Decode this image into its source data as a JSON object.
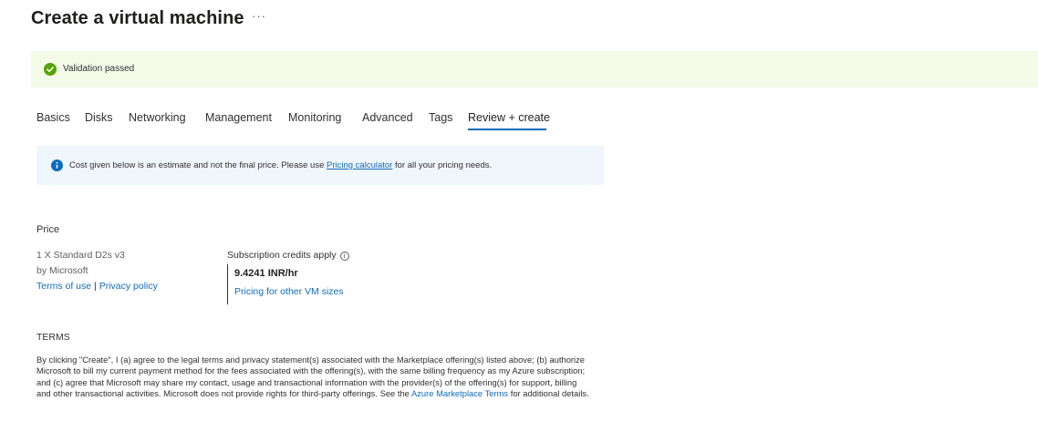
{
  "header": {
    "title": "Create a virtual machine",
    "more_label": "···"
  },
  "banner": {
    "text": "Validation passed",
    "color": "#57a300",
    "icon": "checkmark-circle-icon"
  },
  "tabs": [
    {
      "label": "Basics",
      "active": false
    },
    {
      "label": "Disks",
      "active": false
    },
    {
      "label": "Networking",
      "active": false
    },
    {
      "label": "Management",
      "active": false
    },
    {
      "label": "Monitoring",
      "active": false
    },
    {
      "label": "Advanced",
      "active": false
    },
    {
      "label": "Tags",
      "active": false
    },
    {
      "label": "Review + create",
      "active": true
    }
  ],
  "info_bar": {
    "icon": "info-icon",
    "text_before": "Cost given below is an estimate and not the final price. Please use ",
    "link": "Pricing calculator",
    "text_after": " for all your pricing needs."
  },
  "price": {
    "section_title": "Price",
    "vm_size": "1 X Standard D2s v3",
    "publisher": "by Microsoft",
    "terms_link": "Terms of use",
    "separator": "|",
    "privacy_link": "Privacy policy",
    "credits_label": "Subscription credits apply",
    "rate": "9.4241 INR/hr",
    "other_sizes_link": "Pricing for other VM sizes"
  },
  "terms": {
    "section_title": "TERMS",
    "body_before": "By clicking \"Create\", I (a) agree to the legal terms and privacy statement(s) associated with the Marketplace offering(s) listed above; (b) authorize Microsoft to bill my current payment method for the fees associated with the offering(s), with the same billing frequency as my Azure subscription; and (c) agree that Microsoft may share my contact, usage and transactional information with the provider(s) of the offering(s) for support, billing and other transactional activities. Microsoft does not provide rights for third-party offerings. See the ",
    "link": "Azure Marketplace Terms",
    "body_after": " for additional details."
  }
}
